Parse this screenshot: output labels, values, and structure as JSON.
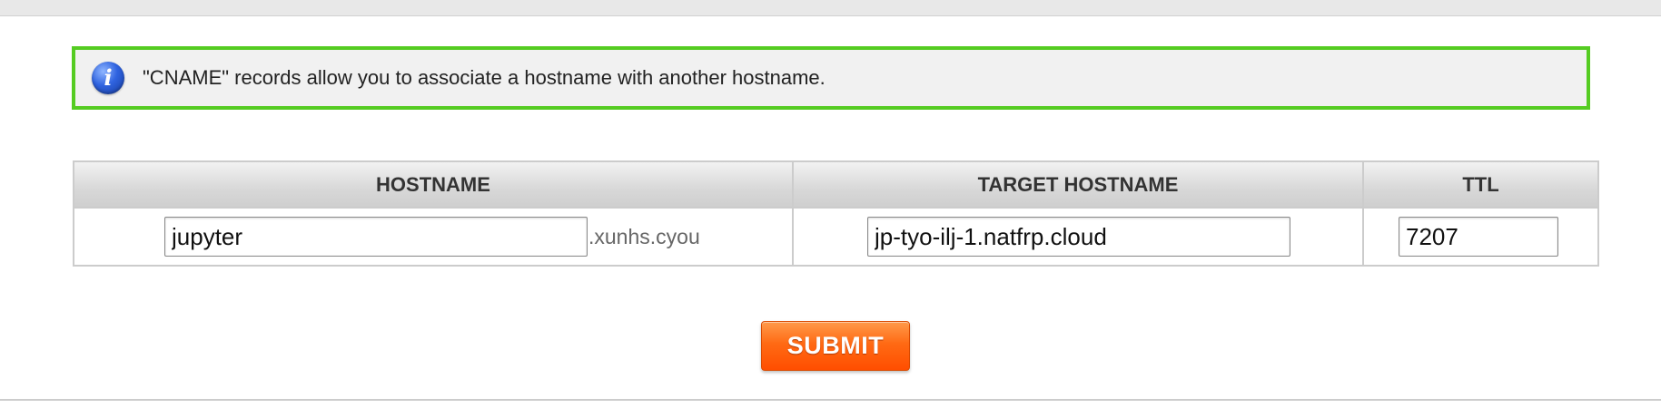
{
  "info": {
    "icon": "info-icon",
    "icon_glyph": "i",
    "message": "\"CNAME\" records allow you to associate a hostname with another hostname.",
    "border_color": "#55cc22"
  },
  "table": {
    "headers": {
      "hostname": "HOSTNAME",
      "target_hostname": "TARGET HOSTNAME",
      "ttl": "TTL"
    },
    "row": {
      "hostname_value": "jupyter",
      "domain_suffix": ".xunhs.cyou",
      "target_hostname_value": "jp-tyo-ilj-1.natfrp.cloud",
      "ttl_value": "7207"
    }
  },
  "form": {
    "submit_label": "SUBMIT",
    "submit_color": "#ff5a00"
  }
}
